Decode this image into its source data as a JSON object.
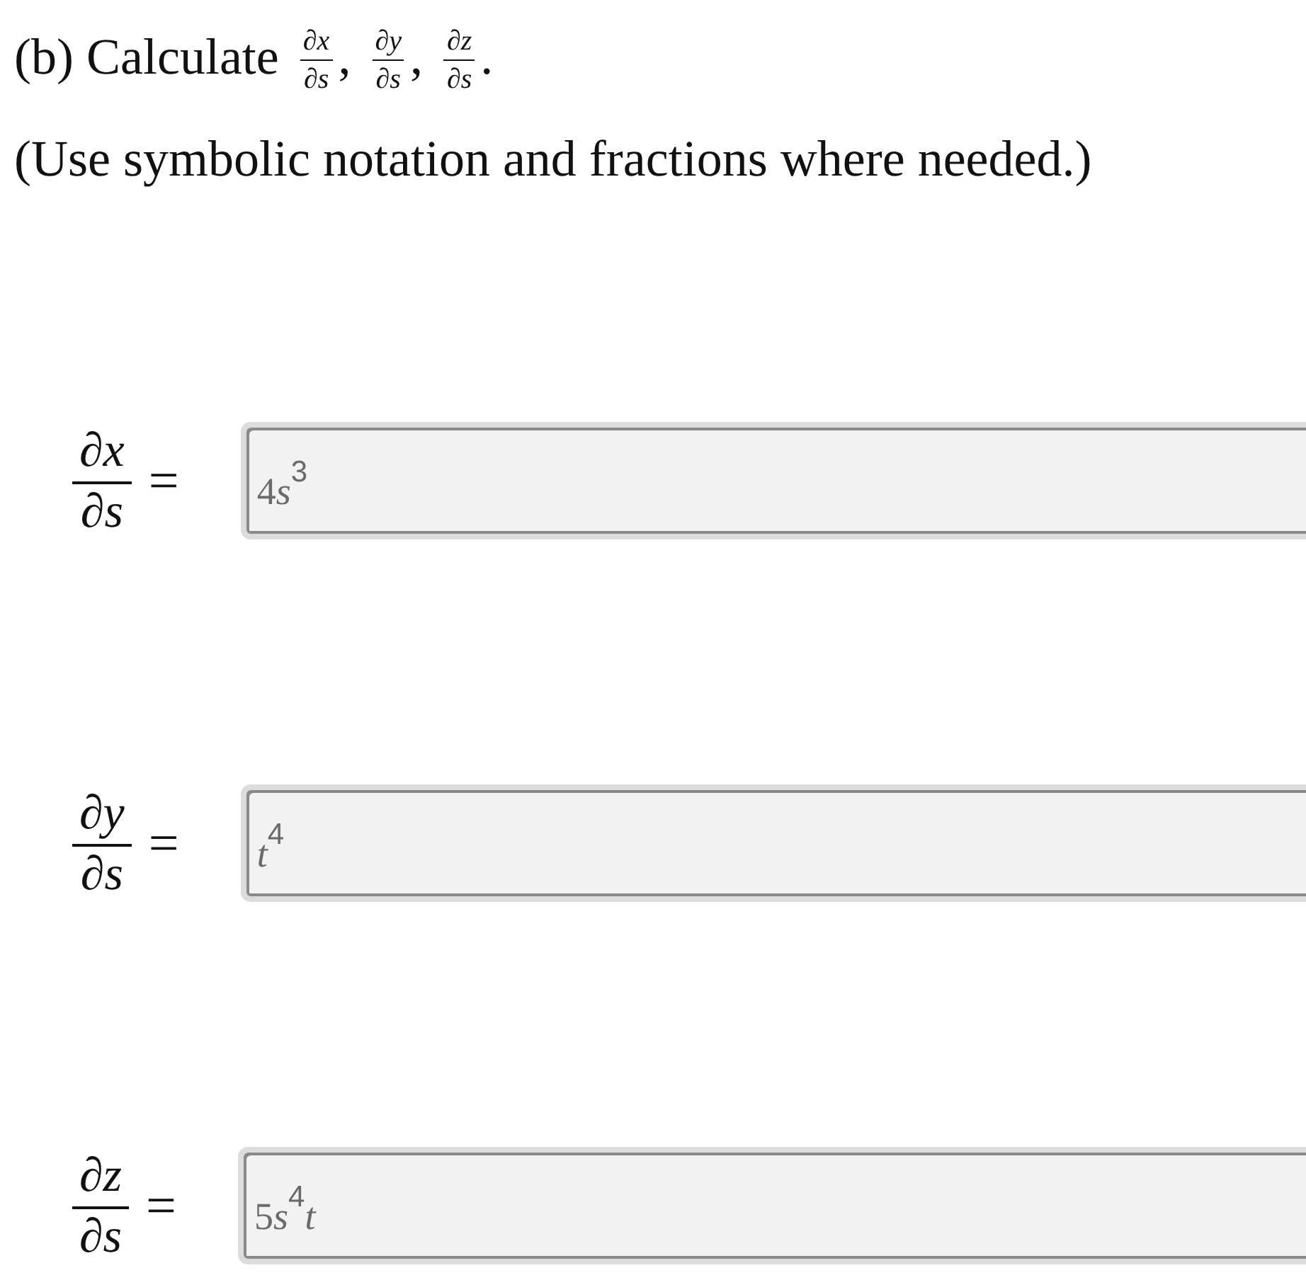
{
  "question": {
    "label": "(b) Calculate",
    "terms": [
      {
        "numerator": "∂x",
        "denominator": "∂s",
        "punctuation": ","
      },
      {
        "numerator": "∂y",
        "denominator": "∂s",
        "punctuation": ","
      },
      {
        "numerator": "∂z",
        "denominator": "∂s",
        "punctuation": "."
      }
    ]
  },
  "instruction": "(Use symbolic notation and fractions where needed.)",
  "answers": [
    {
      "numerator": "∂x",
      "denominator": "∂s",
      "relation": "=",
      "value": [
        {
          "kind": "number",
          "text": "4"
        },
        {
          "kind": "variable",
          "text": "s"
        },
        {
          "kind": "exponent",
          "text": "3"
        }
      ]
    },
    {
      "numerator": "∂y",
      "denominator": "∂s",
      "relation": "=",
      "value": [
        {
          "kind": "variable",
          "text": "t"
        },
        {
          "kind": "exponent",
          "text": "4"
        }
      ]
    },
    {
      "numerator": "∂z",
      "denominator": "∂s",
      "relation": "=",
      "value": [
        {
          "kind": "number",
          "text": "5"
        },
        {
          "kind": "variable",
          "text": "s"
        },
        {
          "kind": "exponent",
          "text": "4"
        },
        {
          "kind": "variable",
          "text": "t"
        }
      ]
    }
  ]
}
